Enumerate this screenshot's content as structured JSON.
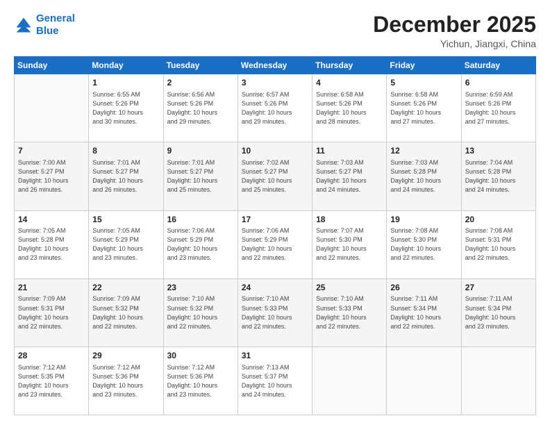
{
  "header": {
    "logo_line1": "General",
    "logo_line2": "Blue",
    "month": "December 2025",
    "location": "Yichun, Jiangxi, China"
  },
  "days_of_week": [
    "Sunday",
    "Monday",
    "Tuesday",
    "Wednesday",
    "Thursday",
    "Friday",
    "Saturday"
  ],
  "weeks": [
    [
      {
        "day": "",
        "info": ""
      },
      {
        "day": "1",
        "info": "Sunrise: 6:55 AM\nSunset: 5:26 PM\nDaylight: 10 hours\nand 30 minutes."
      },
      {
        "day": "2",
        "info": "Sunrise: 6:56 AM\nSunset: 5:26 PM\nDaylight: 10 hours\nand 29 minutes."
      },
      {
        "day": "3",
        "info": "Sunrise: 6:57 AM\nSunset: 5:26 PM\nDaylight: 10 hours\nand 29 minutes."
      },
      {
        "day": "4",
        "info": "Sunrise: 6:58 AM\nSunset: 5:26 PM\nDaylight: 10 hours\nand 28 minutes."
      },
      {
        "day": "5",
        "info": "Sunrise: 6:58 AM\nSunset: 5:26 PM\nDaylight: 10 hours\nand 27 minutes."
      },
      {
        "day": "6",
        "info": "Sunrise: 6:59 AM\nSunset: 5:26 PM\nDaylight: 10 hours\nand 27 minutes."
      }
    ],
    [
      {
        "day": "7",
        "info": "Sunrise: 7:00 AM\nSunset: 5:27 PM\nDaylight: 10 hours\nand 26 minutes."
      },
      {
        "day": "8",
        "info": "Sunrise: 7:01 AM\nSunset: 5:27 PM\nDaylight: 10 hours\nand 26 minutes."
      },
      {
        "day": "9",
        "info": "Sunrise: 7:01 AM\nSunset: 5:27 PM\nDaylight: 10 hours\nand 25 minutes."
      },
      {
        "day": "10",
        "info": "Sunrise: 7:02 AM\nSunset: 5:27 PM\nDaylight: 10 hours\nand 25 minutes."
      },
      {
        "day": "11",
        "info": "Sunrise: 7:03 AM\nSunset: 5:27 PM\nDaylight: 10 hours\nand 24 minutes."
      },
      {
        "day": "12",
        "info": "Sunrise: 7:03 AM\nSunset: 5:28 PM\nDaylight: 10 hours\nand 24 minutes."
      },
      {
        "day": "13",
        "info": "Sunrise: 7:04 AM\nSunset: 5:28 PM\nDaylight: 10 hours\nand 24 minutes."
      }
    ],
    [
      {
        "day": "14",
        "info": "Sunrise: 7:05 AM\nSunset: 5:28 PM\nDaylight: 10 hours\nand 23 minutes."
      },
      {
        "day": "15",
        "info": "Sunrise: 7:05 AM\nSunset: 5:29 PM\nDaylight: 10 hours\nand 23 minutes."
      },
      {
        "day": "16",
        "info": "Sunrise: 7:06 AM\nSunset: 5:29 PM\nDaylight: 10 hours\nand 23 minutes."
      },
      {
        "day": "17",
        "info": "Sunrise: 7:06 AM\nSunset: 5:29 PM\nDaylight: 10 hours\nand 22 minutes."
      },
      {
        "day": "18",
        "info": "Sunrise: 7:07 AM\nSunset: 5:30 PM\nDaylight: 10 hours\nand 22 minutes."
      },
      {
        "day": "19",
        "info": "Sunrise: 7:08 AM\nSunset: 5:30 PM\nDaylight: 10 hours\nand 22 minutes."
      },
      {
        "day": "20",
        "info": "Sunrise: 7:08 AM\nSunset: 5:31 PM\nDaylight: 10 hours\nand 22 minutes."
      }
    ],
    [
      {
        "day": "21",
        "info": "Sunrise: 7:09 AM\nSunset: 5:31 PM\nDaylight: 10 hours\nand 22 minutes."
      },
      {
        "day": "22",
        "info": "Sunrise: 7:09 AM\nSunset: 5:32 PM\nDaylight: 10 hours\nand 22 minutes."
      },
      {
        "day": "23",
        "info": "Sunrise: 7:10 AM\nSunset: 5:32 PM\nDaylight: 10 hours\nand 22 minutes."
      },
      {
        "day": "24",
        "info": "Sunrise: 7:10 AM\nSunset: 5:33 PM\nDaylight: 10 hours\nand 22 minutes."
      },
      {
        "day": "25",
        "info": "Sunrise: 7:10 AM\nSunset: 5:33 PM\nDaylight: 10 hours\nand 22 minutes."
      },
      {
        "day": "26",
        "info": "Sunrise: 7:11 AM\nSunset: 5:34 PM\nDaylight: 10 hours\nand 22 minutes."
      },
      {
        "day": "27",
        "info": "Sunrise: 7:11 AM\nSunset: 5:34 PM\nDaylight: 10 hours\nand 23 minutes."
      }
    ],
    [
      {
        "day": "28",
        "info": "Sunrise: 7:12 AM\nSunset: 5:35 PM\nDaylight: 10 hours\nand 23 minutes."
      },
      {
        "day": "29",
        "info": "Sunrise: 7:12 AM\nSunset: 5:36 PM\nDaylight: 10 hours\nand 23 minutes."
      },
      {
        "day": "30",
        "info": "Sunrise: 7:12 AM\nSunset: 5:36 PM\nDaylight: 10 hours\nand 23 minutes."
      },
      {
        "day": "31",
        "info": "Sunrise: 7:13 AM\nSunset: 5:37 PM\nDaylight: 10 hours\nand 24 minutes."
      },
      {
        "day": "",
        "info": ""
      },
      {
        "day": "",
        "info": ""
      },
      {
        "day": "",
        "info": ""
      }
    ]
  ]
}
